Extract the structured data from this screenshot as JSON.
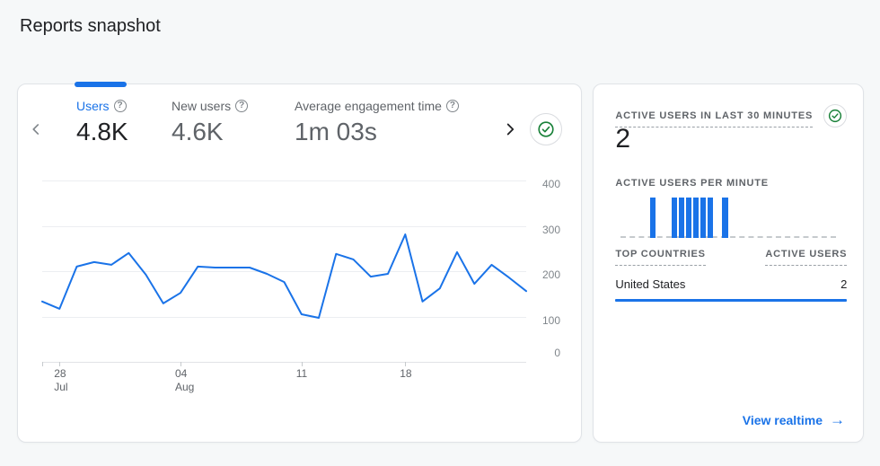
{
  "page": {
    "title": "Reports snapshot"
  },
  "colors": {
    "accent": "#1a73e8",
    "text_primary": "#202124",
    "text_secondary": "#5f6368",
    "green_check": "#188038",
    "card_border": "#dadce0",
    "gridline": "#eceef1"
  },
  "icons": {
    "help_glyph": "?",
    "arrow_right": "→"
  },
  "overview_card": {
    "metrics": [
      {
        "label": "Users",
        "value": "4.8K",
        "selected": true
      },
      {
        "label": "New users",
        "value": "4.6K",
        "selected": false
      },
      {
        "label": "Average engagement time",
        "value": "1m 03s",
        "selected": false
      }
    ],
    "chart_data": {
      "type": "line",
      "title": "Users trend (last 30 days)",
      "series": [
        {
          "name": "Users",
          "values": [
            133,
            117,
            210,
            220,
            214,
            240,
            192,
            129,
            152,
            210,
            208,
            208,
            208,
            194,
            176,
            105,
            97,
            238,
            226,
            188,
            194,
            281,
            133,
            162,
            242,
            172,
            214,
            186,
            156
          ]
        }
      ],
      "ylim": [
        0,
        400
      ],
      "y_ticks": [
        0,
        100,
        200,
        300,
        400
      ],
      "y_axis_side": "right",
      "grid": true,
      "legend": false,
      "x_ticks": [
        {
          "label": "",
          "sublabel": "",
          "index": 0
        },
        {
          "label": "28",
          "sublabel": "Jul",
          "index": 1
        },
        {
          "label": "04",
          "sublabel": "Aug",
          "index": 8
        },
        {
          "label": "11",
          "sublabel": "",
          "index": 15
        },
        {
          "label": "18",
          "sublabel": "",
          "index": 21
        }
      ]
    }
  },
  "realtime_card": {
    "title": "ACTIVE USERS IN LAST 30 MINUTES",
    "value": "2",
    "per_minute_label": "ACTIVE USERS PER MINUTE",
    "chart_data": {
      "type": "bar",
      "title": "Active users per minute (last 30 minutes)",
      "values": [
        0,
        0,
        0,
        0,
        1,
        0,
        0,
        1,
        1,
        1,
        1,
        1,
        1,
        0,
        1,
        0,
        0,
        0,
        0,
        0,
        0,
        0,
        0,
        0,
        0,
        0,
        0,
        0,
        0,
        0
      ],
      "ylim": [
        0,
        1
      ]
    },
    "table": {
      "headers": [
        "TOP COUNTRIES",
        "ACTIVE USERS"
      ],
      "rows": [
        {
          "country": "United States",
          "active_users": "2",
          "share": 1
        }
      ]
    },
    "link_label": "View realtime"
  }
}
